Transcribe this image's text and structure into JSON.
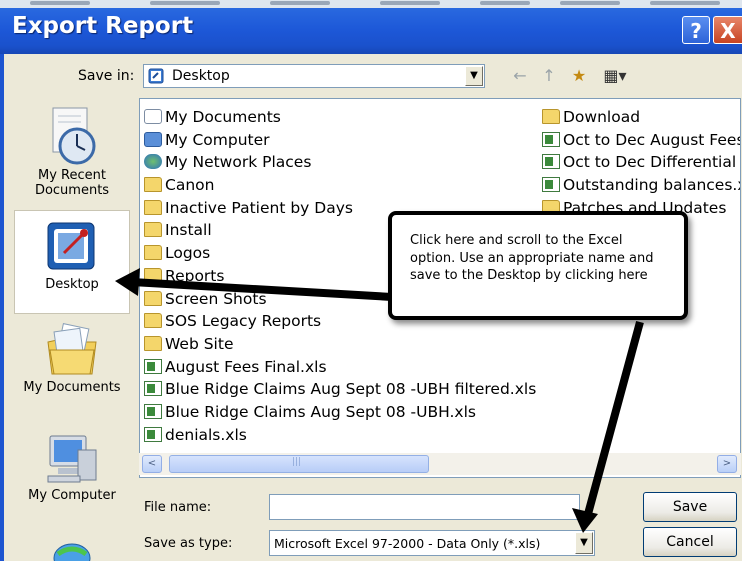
{
  "window": {
    "title": "Export Report",
    "help_glyph": "?",
    "close_glyph": "X"
  },
  "save_in": {
    "label": "Save in:",
    "value": "Desktop"
  },
  "toolbar": {
    "back_glyph": "←",
    "up_glyph": "↑",
    "new_folder_glyph": "★",
    "views_glyph": "▦▾"
  },
  "places": [
    {
      "name": "My Recent Documents",
      "line1": "My Recent",
      "line2": "Documents"
    },
    {
      "name": "Desktop",
      "line1": "Desktop",
      "line2": ""
    },
    {
      "name": "My Documents",
      "line1": "My Documents",
      "line2": ""
    },
    {
      "name": "My Computer",
      "line1": "My Computer",
      "line2": ""
    }
  ],
  "files_left": [
    {
      "name": "My Documents",
      "icon": "documents-icon"
    },
    {
      "name": "My Computer",
      "icon": "computer-icon"
    },
    {
      "name": "My Network Places",
      "icon": "network-icon"
    },
    {
      "name": "Canon",
      "icon": "folder-icon"
    },
    {
      "name": "Inactive Patient by Days",
      "icon": "folder-icon"
    },
    {
      "name": "Install",
      "icon": "folder-icon"
    },
    {
      "name": "Logos",
      "icon": "folder-icon"
    },
    {
      "name": "Reports",
      "icon": "folder-icon"
    },
    {
      "name": "Screen Shots",
      "icon": "folder-icon"
    },
    {
      "name": "SOS Legacy Reports",
      "icon": "folder-icon"
    },
    {
      "name": "Web Site",
      "icon": "folder-icon"
    },
    {
      "name": "August Fees Final.xls",
      "icon": "excel-icon"
    },
    {
      "name": "Blue Ridge Claims Aug Sept 08 -UBH filtered.xls",
      "icon": "excel-icon"
    },
    {
      "name": "Blue Ridge Claims Aug Sept 08 -UBH.xls",
      "icon": "excel-icon"
    },
    {
      "name": "denials.xls",
      "icon": "excel-icon"
    }
  ],
  "files_right": [
    {
      "name": "Download",
      "icon": "folder-icon"
    },
    {
      "name": "Oct to Dec August Fees",
      "icon": "excel-icon"
    },
    {
      "name": "Oct to Dec Differential",
      "icon": "excel-icon"
    },
    {
      "name": "Outstanding balances.xls",
      "icon": "excel-icon"
    },
    {
      "name": "Patches and Updates",
      "icon": "folder-icon"
    }
  ],
  "scrollbar": {
    "left_glyph": "<",
    "right_glyph": ">",
    "grip_glyph": "|||"
  },
  "file_name": {
    "label": "File name:",
    "value": ""
  },
  "save_as_type": {
    "label": "Save as type:",
    "value": "Microsoft Excel 97-2000 - Data Only (*.xls)"
  },
  "buttons": {
    "save": "Save",
    "cancel": "Cancel"
  },
  "callout": {
    "text": "Click here and scroll to the Excel option.  Use an appropriate name and save to the Desktop by clicking here"
  },
  "colors": {
    "titlebar": "#1d58d8",
    "face": "#ECE9D8",
    "list_border": "#7f9db9",
    "folder": "#f4d66b",
    "excel": "#3b8a3b"
  }
}
